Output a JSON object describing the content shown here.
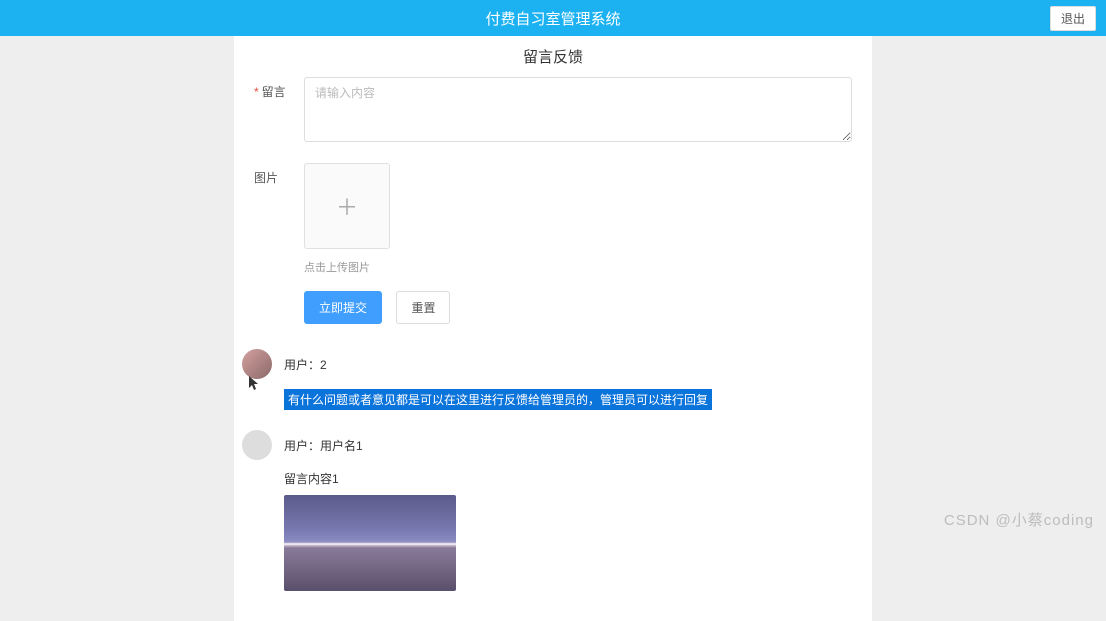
{
  "header": {
    "title": "付费自习室管理系统",
    "logout_label": "退出"
  },
  "page": {
    "title": "留言反馈"
  },
  "form": {
    "message_label": "留言",
    "message_placeholder": "请输入内容",
    "image_label": "图片",
    "upload_hint": "点击上传图片",
    "submit_label": "立即提交",
    "reset_label": "重置"
  },
  "messages": [
    {
      "user_prefix": "用户：",
      "user_name": "2",
      "content": "有什么问题或者意见都是可以在这里进行反馈给管理员的，管理员可以进行回复",
      "highlighted": true,
      "has_image": false
    },
    {
      "user_prefix": "用户：",
      "user_name": "用户名1",
      "content": "留言内容1",
      "highlighted": false,
      "has_image": true
    }
  ],
  "watermark": "CSDN @小蔡coding"
}
